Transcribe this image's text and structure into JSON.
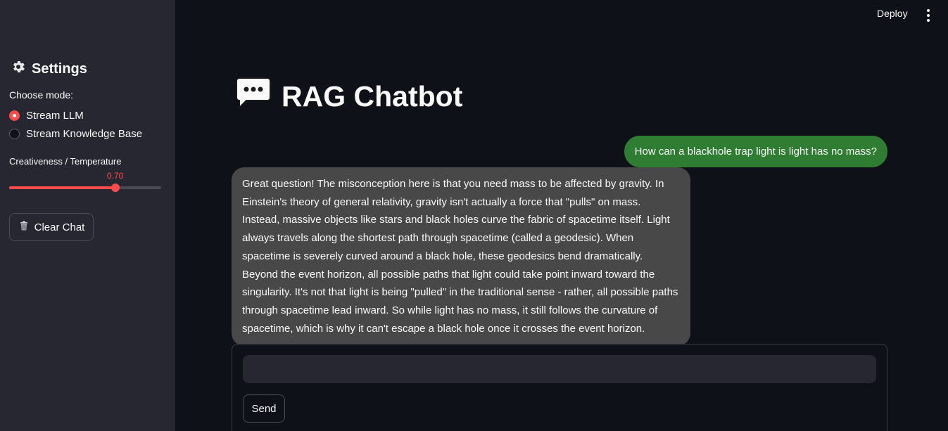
{
  "sidebar": {
    "title": "Settings",
    "mode_label": "Choose mode:",
    "modes": [
      {
        "label": "Stream LLM",
        "selected": true
      },
      {
        "label": "Stream Knowledge Base",
        "selected": false
      }
    ],
    "temperature": {
      "label": "Creativeness / Temperature",
      "value": "0.70",
      "fraction": 0.7
    },
    "clear_label": "Clear Chat"
  },
  "header": {
    "deploy_label": "Deploy"
  },
  "main": {
    "title": "RAG Chatbot",
    "messages": [
      {
        "role": "user",
        "text": "How can a blackhole trap light is light has no mass?"
      },
      {
        "role": "assistant",
        "text": "Great question! The misconception here is that you need mass to be affected by gravity. In Einstein's theory of general relativity, gravity isn't actually a force that \"pulls\" on mass. Instead, massive objects like stars and black holes curve the fabric of spacetime itself. Light always travels along the shortest path through spacetime (called a geodesic). When spacetime is severely curved around a black hole, these geodesics bend dramatically. Beyond the event horizon, all possible paths that light could take point inward toward the singularity. It's not that light is being \"pulled\" in the traditional sense - rather, all possible paths through spacetime lead inward. So while light has no mass, it still follows the curvature of spacetime, which is why it can't escape a black hole once it crosses the event horizon."
      }
    ],
    "input": {
      "value": "",
      "placeholder": ""
    },
    "send_label": "Send"
  },
  "colors": {
    "accent": "#ff4b4b",
    "user_bubble": "#2e7d32",
    "assistant_bubble": "#484848",
    "background": "#0e1117",
    "sidebar": "#262730"
  },
  "icons": {
    "settings": "gear-icon",
    "title": "speech-balloon-icon",
    "clear": "wastebasket-icon",
    "menu": "kebab-menu-icon"
  }
}
